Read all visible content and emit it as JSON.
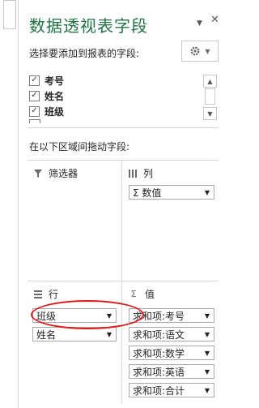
{
  "panel": {
    "title": "数据透视表字段",
    "subtitle": "选择要添加到报表的字段:",
    "drag_label": "在以下区域间拖动字段:",
    "dropdown_caret": "▼",
    "close_glyph": "✕",
    "scroll_up": "▲",
    "scroll_down": "▼",
    "check_glyph": "✓"
  },
  "fields": [
    {
      "label": "考号",
      "checked": true
    },
    {
      "label": "姓名",
      "checked": true
    },
    {
      "label": "班级",
      "checked": true
    }
  ],
  "areas": {
    "filters": {
      "title": "筛选器",
      "icon": "filter-icon"
    },
    "columns": {
      "title": "列",
      "icon": "columns-icon",
      "items": [
        "Σ 数值"
      ]
    },
    "rows": {
      "title": "行",
      "icon": "rows-icon",
      "items": [
        "班级",
        "姓名"
      ]
    },
    "values": {
      "title": "值",
      "icon": "sigma-icon",
      "items": [
        "求和项:考号",
        "求和项:语文",
        "求和项:数学",
        "求和项:英语",
        "求和项:合计"
      ]
    }
  },
  "colors": {
    "title": "#217346",
    "annotation": "#e01818"
  }
}
